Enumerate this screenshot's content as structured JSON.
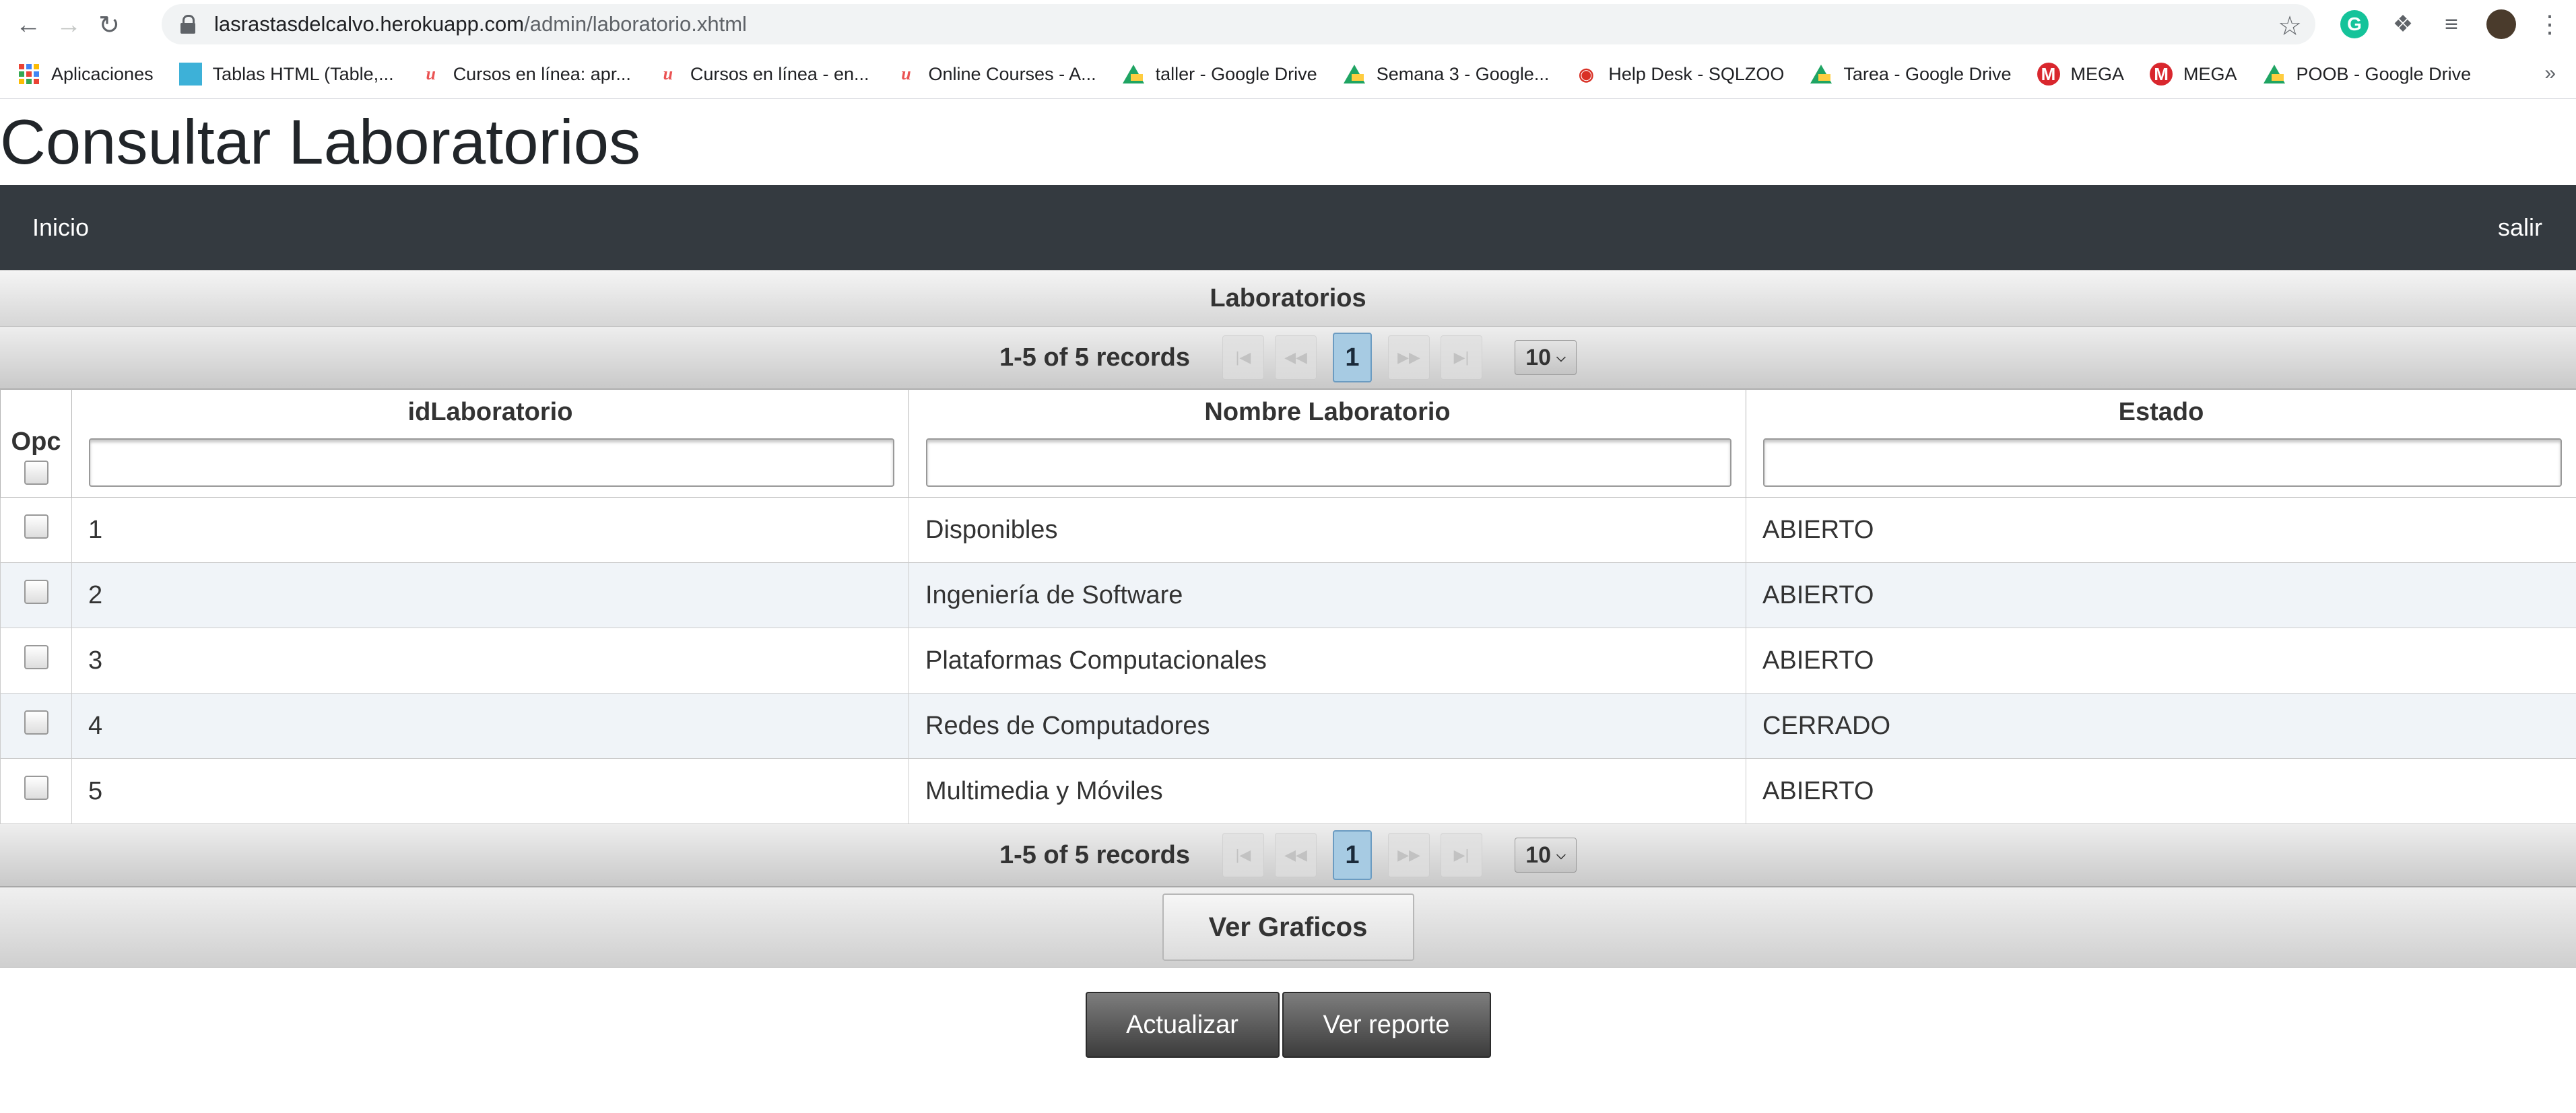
{
  "browser": {
    "url_host": "lasrastasdelcalvo.herokuapp.com",
    "url_path": "/admin/laboratorio.xhtml",
    "bookmarks": [
      {
        "label": "Aplicaciones",
        "icon": "apps-icon"
      },
      {
        "label": "Tablas HTML (Table,...",
        "icon": "table-icon"
      },
      {
        "label": "Cursos en línea: apr...",
        "icon": "udemy-icon"
      },
      {
        "label": "Cursos en línea - en...",
        "icon": "udemy-icon"
      },
      {
        "label": "Online Courses - A...",
        "icon": "udemy-icon"
      },
      {
        "label": "taller - Google Drive",
        "icon": "google-drive-icon"
      },
      {
        "label": "Semana 3 - Google...",
        "icon": "google-drive-icon"
      },
      {
        "label": "Help Desk - SQLZOO",
        "icon": "sqlzoo-icon"
      },
      {
        "label": "Tarea - Google Drive",
        "icon": "google-drive-icon"
      },
      {
        "label": "MEGA",
        "icon": "mega-icon"
      },
      {
        "label": "MEGA",
        "icon": "mega-icon"
      },
      {
        "label": "POOB - Google Drive",
        "icon": "google-drive-icon"
      }
    ],
    "more_label": "»"
  },
  "page": {
    "title": "Consultar Laboratorios",
    "nav_home": "Inicio",
    "nav_logout": "salir"
  },
  "table": {
    "caption": "Laboratorios",
    "records_text": "1-5 of 5 records",
    "current_page": "1",
    "rows_per_page": "10",
    "columns": {
      "opc": "Opc",
      "id": "idLaboratorio",
      "name": "Nombre Laboratorio",
      "status": "Estado"
    },
    "rows": [
      {
        "id": "1",
        "name": "Disponibles",
        "status": "ABIERTO"
      },
      {
        "id": "2",
        "name": "Ingeniería de Software",
        "status": "ABIERTO"
      },
      {
        "id": "3",
        "name": "Plataformas Computacionales",
        "status": "ABIERTO"
      },
      {
        "id": "4",
        "name": "Redes de Computadores",
        "status": "CERRADO"
      },
      {
        "id": "5",
        "name": "Multimedia y Móviles",
        "status": "ABIERTO"
      }
    ]
  },
  "actions": {
    "graphs": "Ver Graficos",
    "update": "Actualizar",
    "report": "Ver reporte"
  }
}
